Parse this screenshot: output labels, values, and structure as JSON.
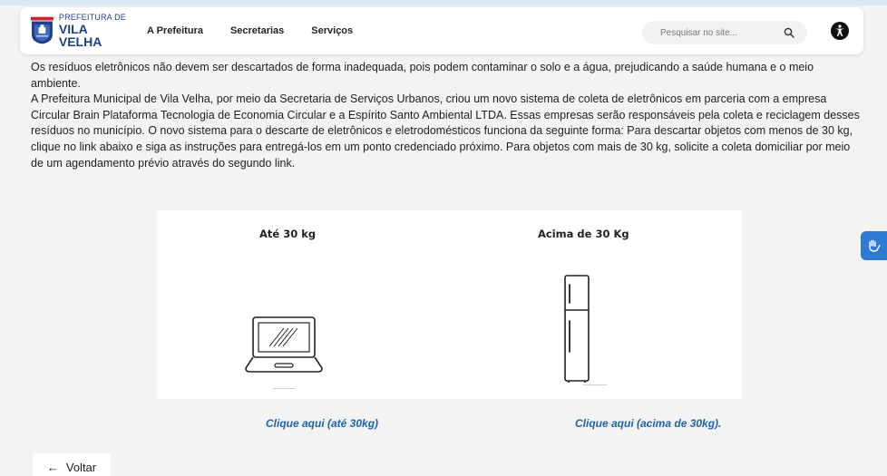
{
  "header": {
    "logo_top": "PREFEITURA DE",
    "logo_bottom": "VILA VELHA",
    "nav": [
      "A Prefeitura",
      "Secretarias",
      "Serviços"
    ],
    "search_placeholder": "Pesquisar no site...",
    "search_icon": "search-icon",
    "accessibility_icon": "accessibility-icon"
  },
  "content": {
    "paragraph1": "Os resíduos eletrônicos não devem ser descartados de forma inadequada, pois podem contaminar o solo e a água, prejudicando a saúde humana e o meio ambiente.",
    "paragraph2": "A Prefeitura Municipal de Vila Velha, por meio da Secretaria de Serviços Urbanos, criou um novo sistema de coleta de eletrônicos em parceria com a empresa Circular Brain Plataforma Tecnologia de Economia Circular e a Espírito Santo Ambiental LTDA. Essas empresas serão responsáveis pela coleta e reciclagem desses resíduos no município. O novo sistema para o descarte de eletrônicos e eletrodomésticos funciona da seguinte forma: Para descartar objetos com menos de 30 kg, clique no link abaixo e siga as instruções para entregá-los em um ponto credenciado próximo. Para objetos com mais de 30 kg, solicite a coleta domiciliar por meio de um agendamento prévio através do segundo link."
  },
  "card": {
    "left_label": "Até 30 kg",
    "right_label": "Acima de 30 Kg",
    "left_icon": "laptop-icon",
    "right_icon": "fridge-icon"
  },
  "links": {
    "left": "Clique aqui (até 30kg)",
    "right": "Clique aqui (acima de 30kg)."
  },
  "back_button": {
    "label": "Voltar",
    "icon": "arrow-left-icon"
  },
  "side_widget_icon": "sign-language-icon",
  "colors": {
    "accent_blue": "#1e3f8e",
    "link_blue": "#1f62a8",
    "widget_blue": "#2d79d3"
  }
}
